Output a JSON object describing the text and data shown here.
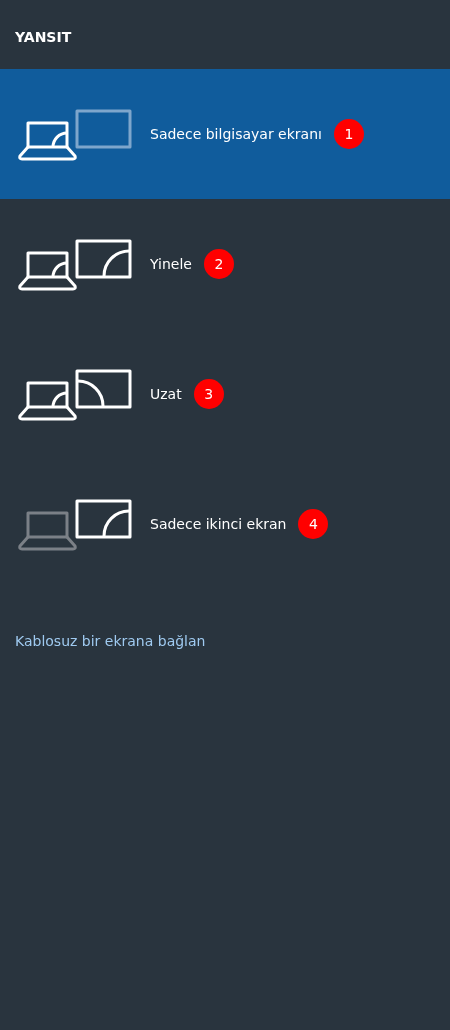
{
  "title": "YANSIT",
  "options": [
    {
      "kind": "pc_only",
      "label": "Sadece bilgisayar ekranı",
      "badge": "1",
      "selected": true
    },
    {
      "kind": "duplicate",
      "label": "Yinele",
      "badge": "2",
      "selected": false
    },
    {
      "kind": "extend",
      "label": "Uzat",
      "badge": "3",
      "selected": false
    },
    {
      "kind": "second_only",
      "label": "Sadece ikinci ekran",
      "badge": "4",
      "selected": false
    }
  ],
  "link": "Kablosuz bir ekrana bağlan"
}
